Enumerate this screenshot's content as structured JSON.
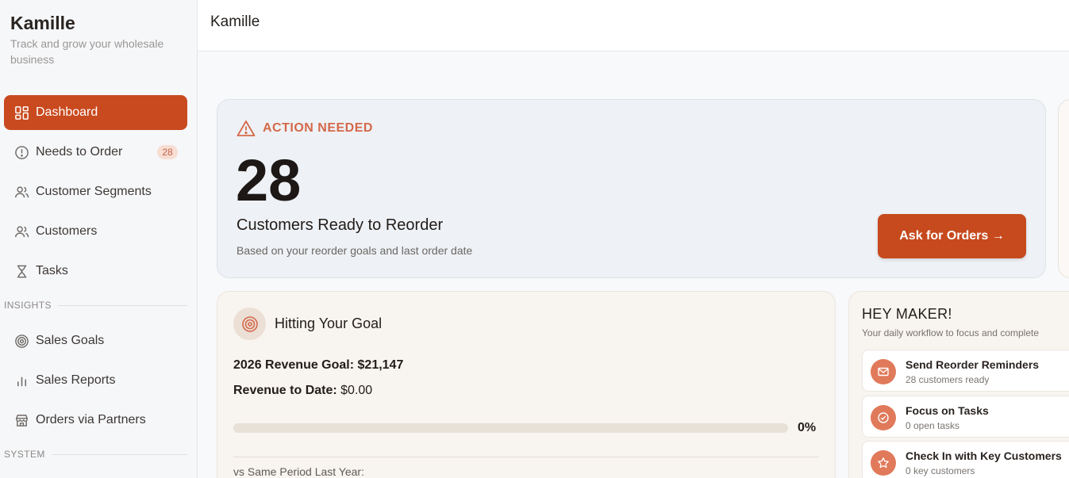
{
  "app": {
    "name": "Kamille",
    "tagline": "Track and grow your wholesale business"
  },
  "sidebar": {
    "items": [
      {
        "label": "Dashboard",
        "icon": "dashboard-icon",
        "active": true
      },
      {
        "label": "Needs to Order",
        "icon": "alert-circle-icon",
        "badge": "28"
      },
      {
        "label": "Customer Segments",
        "icon": "users-icon"
      },
      {
        "label": "Customers",
        "icon": "users-icon"
      },
      {
        "label": "Tasks",
        "icon": "hourglass-icon"
      }
    ],
    "insights_label": "INSIGHTS",
    "insights": [
      {
        "label": "Sales Goals",
        "icon": "target-icon"
      },
      {
        "label": "Sales Reports",
        "icon": "bar-chart-icon"
      },
      {
        "label": "Orders via Partners",
        "icon": "store-icon"
      }
    ],
    "system_label": "SYSTEM"
  },
  "header": {
    "title": "Kamille"
  },
  "action": {
    "heading": "ACTION NEEDED",
    "count": "28",
    "title": "Customers Ready to Reorder",
    "subtitle": "Based on your reorder goals and last order date",
    "button_label": "Ask for Orders →",
    "accent_color": "#c64a1d"
  },
  "goal": {
    "title": "Hitting Your Goal",
    "revenue_goal_label": "2026 Revenue Goal: $21,147",
    "revenue_to_date_label": "Revenue to Date:",
    "revenue_to_date_value": "$0.00",
    "progress_fraction": 0,
    "progress_label": "0%",
    "vs_label": "vs Same Period Last Year:"
  },
  "workflow": {
    "title": "HEY MAKER!",
    "subtitle": "Your daily workflow to focus and complete",
    "items": [
      {
        "title": "Send Reorder Reminders",
        "subtitle": "28 customers ready",
        "icon": "mail-icon"
      },
      {
        "title": "Focus on Tasks",
        "subtitle": "0 open tasks",
        "icon": "check-circle-icon"
      },
      {
        "title": "Check In with Key Customers",
        "subtitle": "0 key customers",
        "icon": "star-icon"
      }
    ]
  }
}
